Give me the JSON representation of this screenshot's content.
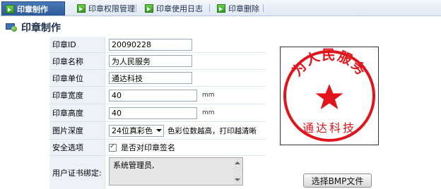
{
  "tabs": [
    {
      "label": "印章制作",
      "active": true
    },
    {
      "label": "印章权限管理",
      "active": false
    },
    {
      "label": "印章使用日志",
      "active": false
    },
    {
      "label": "印章删除",
      "active": false
    }
  ],
  "section_title": "印章制作",
  "form": {
    "seal_id": {
      "label": "印章ID",
      "value": "20090228"
    },
    "seal_name": {
      "label": "印章名称",
      "value": "为人民服务"
    },
    "seal_unit": {
      "label": "印章单位",
      "value": "通达科技"
    },
    "seal_width": {
      "label": "印章宽度",
      "value": "40",
      "unit": "mm"
    },
    "seal_height": {
      "label": "印章高度",
      "value": "40",
      "unit": "mm"
    },
    "color_depth": {
      "label": "图片深度",
      "selected": "24位真彩色",
      "hint": "色彩位数越高，打印越清晰"
    },
    "security": {
      "label": "安全选项",
      "checkbox_label": "是否对印章签名",
      "checked": true
    },
    "cert_binding": {
      "label": "用户证书绑定:",
      "value": "系统管理员,"
    }
  },
  "seal": {
    "top_text": "为人民服务",
    "bottom_text": "通达科技",
    "color": "#e0141a"
  },
  "bmp_button": "选择BMP文件",
  "colors": {
    "tab_active": "#3466a8",
    "label_bg": "#eef2f7",
    "seal_red": "#e0141a"
  }
}
